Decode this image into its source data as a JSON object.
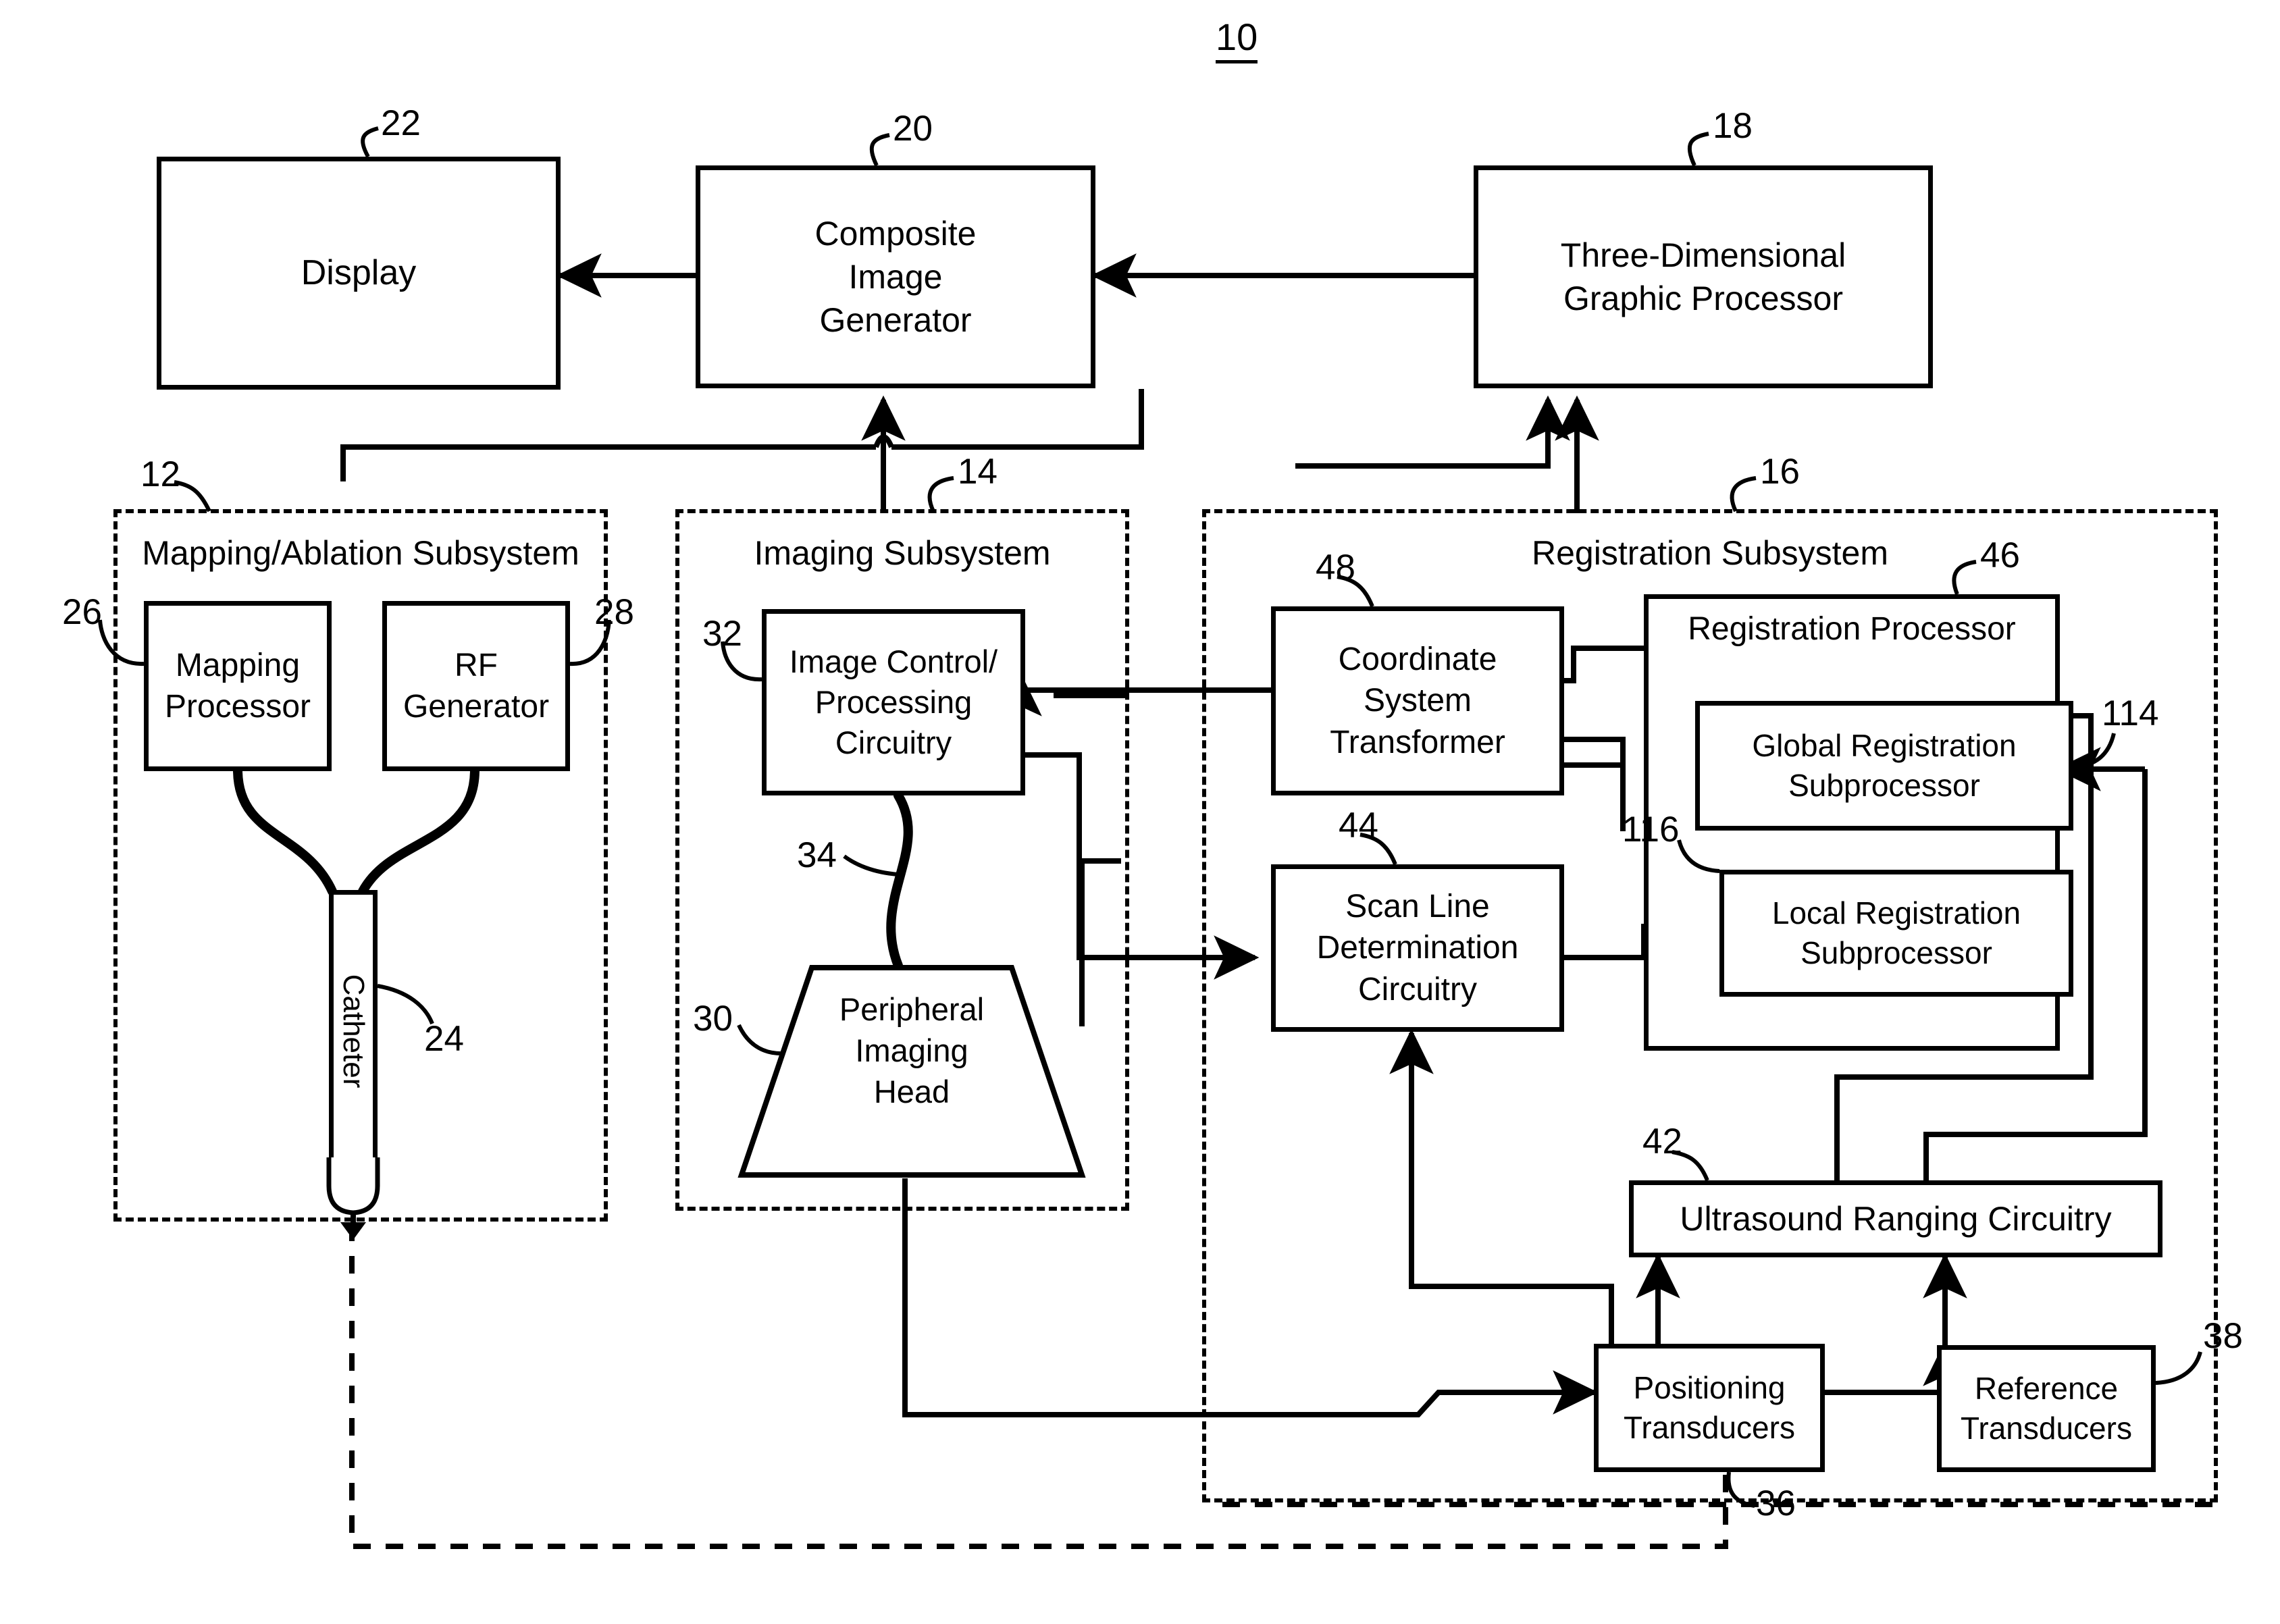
{
  "figure": {
    "number": "10"
  },
  "blocks": {
    "display": {
      "label": "Display",
      "ref": "22"
    },
    "composite": {
      "label": "Composite\nImage\nGenerator",
      "ref": "20"
    },
    "graphic_processor": {
      "label": "Three-Dimensional\nGraphic Processor",
      "ref": "18"
    },
    "mapping_processor": {
      "label": "Mapping\nProcessor",
      "ref": "26"
    },
    "rf_generator": {
      "label": "RF\nGenerator",
      "ref": "28"
    },
    "catheter": {
      "label": "Catheter",
      "ref": "24"
    },
    "image_control": {
      "label": "Image Control/\nProcessing\nCircuitry",
      "ref": "32"
    },
    "peripheral_head": {
      "label": "Peripheral\nImaging\nHead",
      "ref": "30"
    },
    "cable": {
      "label": "",
      "ref": "34"
    },
    "coordinate_xform": {
      "label": "Coordinate\nSystem\nTransformer",
      "ref": "48"
    },
    "scan_line": {
      "label": "Scan Line\nDetermination\nCircuitry",
      "ref": "44"
    },
    "registration_proc": {
      "label": "Registration Processor",
      "ref": "46"
    },
    "global_reg": {
      "label": "Global Registration\nSubprocessor",
      "ref": "114"
    },
    "local_reg": {
      "label": "Local Registration\nSubprocessor",
      "ref": "116"
    },
    "ultrasound_ranging": {
      "label": "Ultrasound Ranging Circuitry",
      "ref": "42"
    },
    "positioning_trans": {
      "label": "Positioning\nTransducers",
      "ref": "36"
    },
    "reference_trans": {
      "label": "Reference\nTransducers",
      "ref": "38"
    }
  },
  "subsystems": {
    "mapping": {
      "title": "Mapping/Ablation Subsystem",
      "ref": "12"
    },
    "imaging": {
      "title": "Imaging Subsystem",
      "ref": "14"
    },
    "registration": {
      "title": "Registration Subsystem",
      "ref": "16"
    }
  },
  "colors": {
    "ink": "#000000",
    "paper": "#ffffff"
  }
}
